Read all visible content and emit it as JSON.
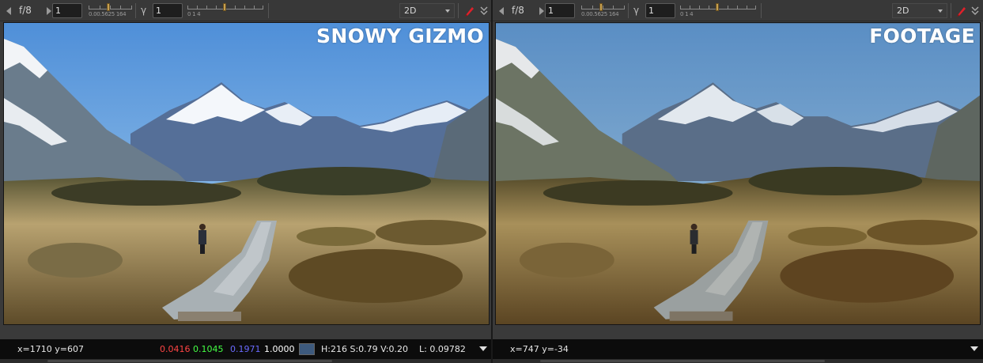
{
  "viewers": [
    {
      "id": "left",
      "toolbar": {
        "fstop": "f/8",
        "gain_value": "1",
        "gain_ticks": "0.00.5625   164",
        "gamma_symbol": "γ",
        "gamma_value": "1",
        "gamma_ticks": "0              1                     4",
        "view_mode": "2D"
      },
      "overlay_title": "SNOWY GIZMO",
      "grade": "snowy",
      "status": {
        "coords": "x=1710 y=607",
        "r": "0.0416",
        "g": "0.1045",
        "b": "0.1971",
        "a": "1.0000",
        "swatch_color": "#3d5a7e",
        "hsv": "H:216 S:0.79 V:0.20",
        "luminance": "L: 0.09782"
      }
    },
    {
      "id": "right",
      "toolbar": {
        "fstop": "f/8",
        "gain_value": "1",
        "gain_ticks": "0.00.5625   164",
        "gamma_symbol": "γ",
        "gamma_value": "1",
        "gamma_ticks": "0              1                     4",
        "view_mode": "2D"
      },
      "overlay_title": "FOOTAGE",
      "grade": "footage",
      "status": {
        "coords": "x=747 y=-34"
      }
    }
  ],
  "colors": {
    "toolbar_bg": "#383838",
    "status_bg": "#0c0c0c",
    "picker_icon": "#e0202a",
    "slider_knob": "#c6a050"
  }
}
